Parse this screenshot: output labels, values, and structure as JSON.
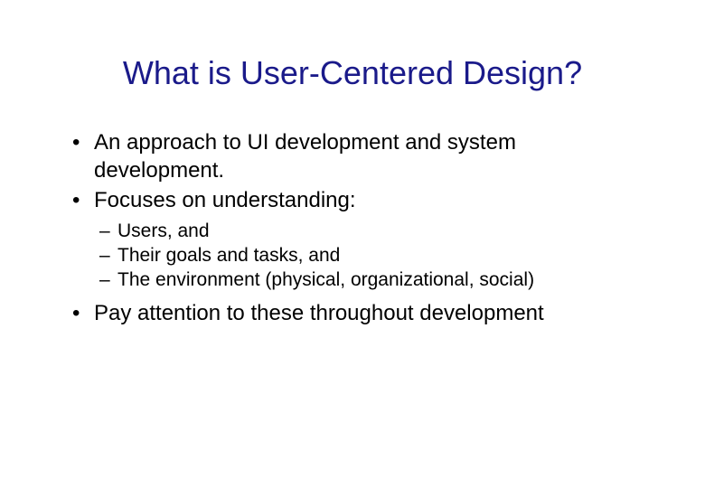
{
  "title": "What is User-Centered Design?",
  "bullets": [
    "An approach to UI development and system development.",
    "Focuses on understanding:",
    "Pay attention to these throughout development"
  ],
  "sub_bullets": [
    "Users, and",
    "Their goals and tasks, and",
    "The environment (physical, organizational, social)"
  ]
}
